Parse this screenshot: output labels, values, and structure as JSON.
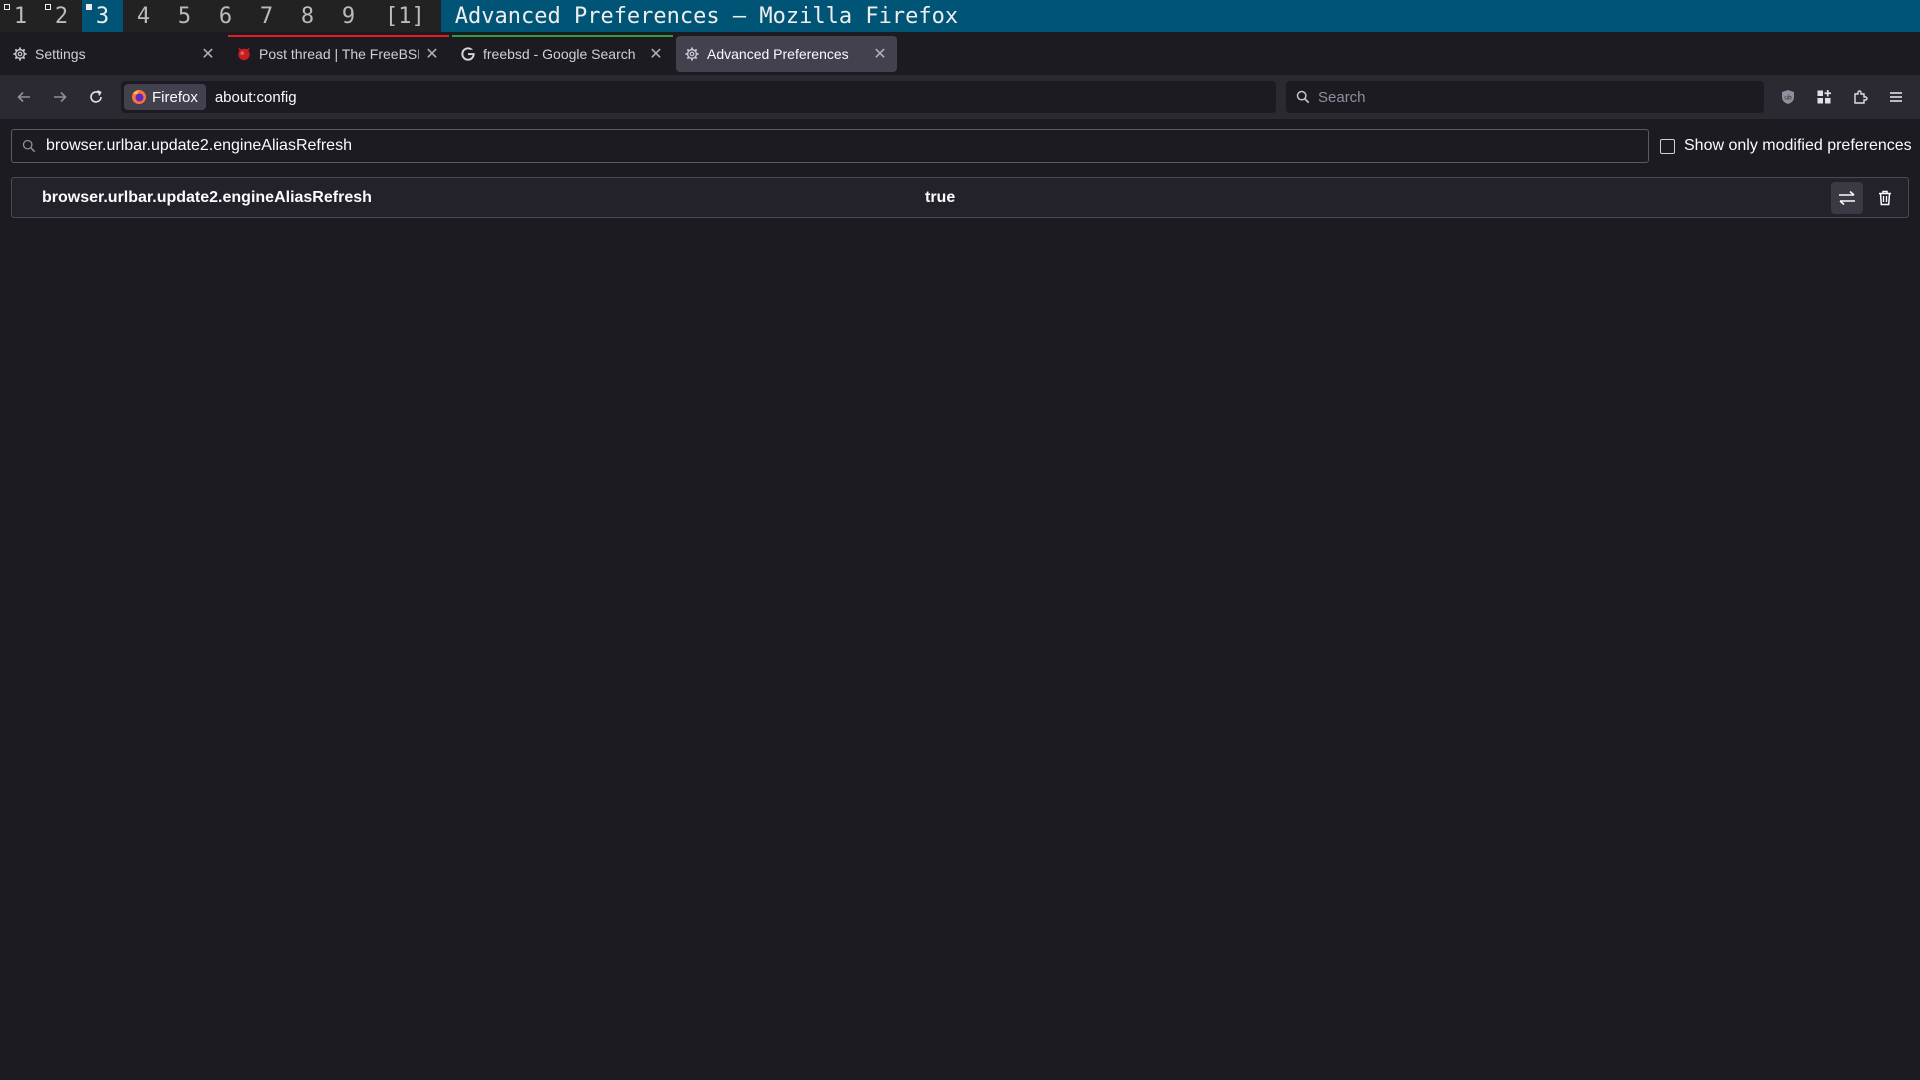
{
  "wm": {
    "workspaces": [
      {
        "label": "1",
        "active": false,
        "mark": "hollow"
      },
      {
        "label": "2",
        "active": false,
        "mark": "hollow"
      },
      {
        "label": "3",
        "active": true,
        "mark": "filled"
      },
      {
        "label": "4",
        "active": false,
        "mark": ""
      },
      {
        "label": "5",
        "active": false,
        "mark": ""
      },
      {
        "label": "6",
        "active": false,
        "mark": ""
      },
      {
        "label": "7",
        "active": false,
        "mark": ""
      },
      {
        "label": "8",
        "active": false,
        "mark": ""
      },
      {
        "label": "9",
        "active": false,
        "mark": ""
      }
    ],
    "layout": "[1]",
    "window_title": "Advanced Preferences — Mozilla Firefox"
  },
  "tabs": [
    {
      "label": "Settings",
      "icon": "gear-icon",
      "selected": false,
      "indicator": ""
    },
    {
      "label": "Post thread | The FreeBSD",
      "icon": "freebsd-icon",
      "selected": false,
      "indicator": "#e02020"
    },
    {
      "label": "freebsd - Google Search",
      "icon": "google-icon",
      "selected": false,
      "indicator": "#2ea043"
    },
    {
      "label": "Advanced Preferences",
      "icon": "gear-icon",
      "selected": true,
      "indicator": ""
    }
  ],
  "urlbar": {
    "identity_label": "Firefox",
    "url": "about:config"
  },
  "searchbar": {
    "placeholder": "Search"
  },
  "config": {
    "search_value": "browser.urlbar.update2.engineAliasRefresh",
    "show_modified_label": "Show only modified preferences",
    "show_modified_checked": false,
    "prefs": [
      {
        "name": "browser.urlbar.update2.engineAliasRefresh",
        "value": "true"
      }
    ]
  },
  "colors": {
    "wm_accent": "#005577",
    "toolbar_bg": "#2b2a33",
    "content_bg": "#1c1b22",
    "freebsd_red": "#e02020",
    "google_green": "#2ea043"
  }
}
